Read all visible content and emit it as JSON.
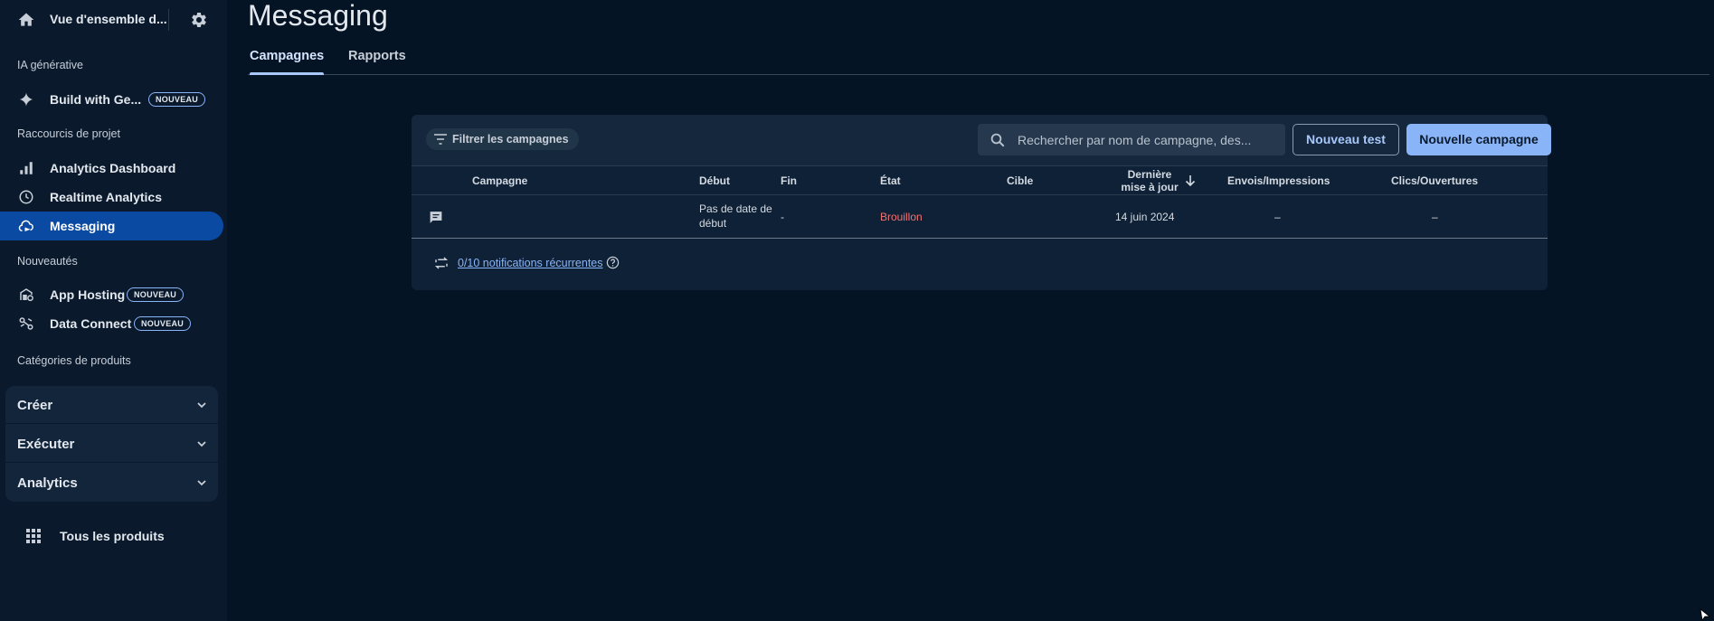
{
  "sidebar": {
    "project_name": "Vue d'ensemble d...",
    "sections": {
      "gen_ai": "IA générative",
      "shortcuts": "Raccourcis de projet",
      "new": "Nouveautés",
      "categories": "Catégories de produits"
    },
    "build": {
      "label": "Build with Ge...",
      "badge": "NOUVEAU"
    },
    "shortcuts": [
      {
        "label": "Analytics Dashboard",
        "icon": "bar-chart-icon"
      },
      {
        "label": "Realtime Analytics",
        "icon": "clock-icon"
      },
      {
        "label": "Messaging",
        "icon": "cloud-message-icon",
        "active": true
      }
    ],
    "new_items": [
      {
        "label": "App Hosting",
        "badge": "NOUVEAU",
        "icon": "hosting-icon"
      },
      {
        "label": "Data Connect",
        "badge": "NOUVEAU",
        "icon": "data-connect-icon"
      }
    ],
    "categories": [
      "Créer",
      "Exécuter",
      "Analytics"
    ],
    "all_products": "Tous les produits"
  },
  "main": {
    "title": "Messaging",
    "tabs": [
      "Campagnes",
      "Rapports"
    ],
    "active_tab": 0
  },
  "toolbar": {
    "filter_label": "Filtrer les campagnes",
    "search_placeholder": "Rechercher par nom de campagne, des...",
    "new_test_label": "Nouveau test",
    "new_campaign_label": "Nouvelle campagne"
  },
  "table": {
    "headers": {
      "campaign": "Campagne",
      "start": "Début",
      "end": "Fin",
      "state": "État",
      "target": "Cible",
      "updated_line1": "Dernière",
      "updated_line2": "mise à jour",
      "sends": "Envois/Impressions",
      "clicks": "Clics/Ouvertures"
    },
    "rows": [
      {
        "campaign": "",
        "start_line1": "Pas de date de",
        "start_line2": "début",
        "end": "-",
        "state": "Brouillon",
        "target": "",
        "updated": "14 juin 2024",
        "sends": "–",
        "clicks": "–"
      }
    ]
  },
  "footer": {
    "recurring_link": "0/10 notifications récurrentes"
  },
  "colors": {
    "background": "#051424",
    "sidebar": "#0a1a2c",
    "active_nav": "#0b4aa2",
    "accent": "#8ab4f8",
    "draft_status": "#f07373"
  }
}
